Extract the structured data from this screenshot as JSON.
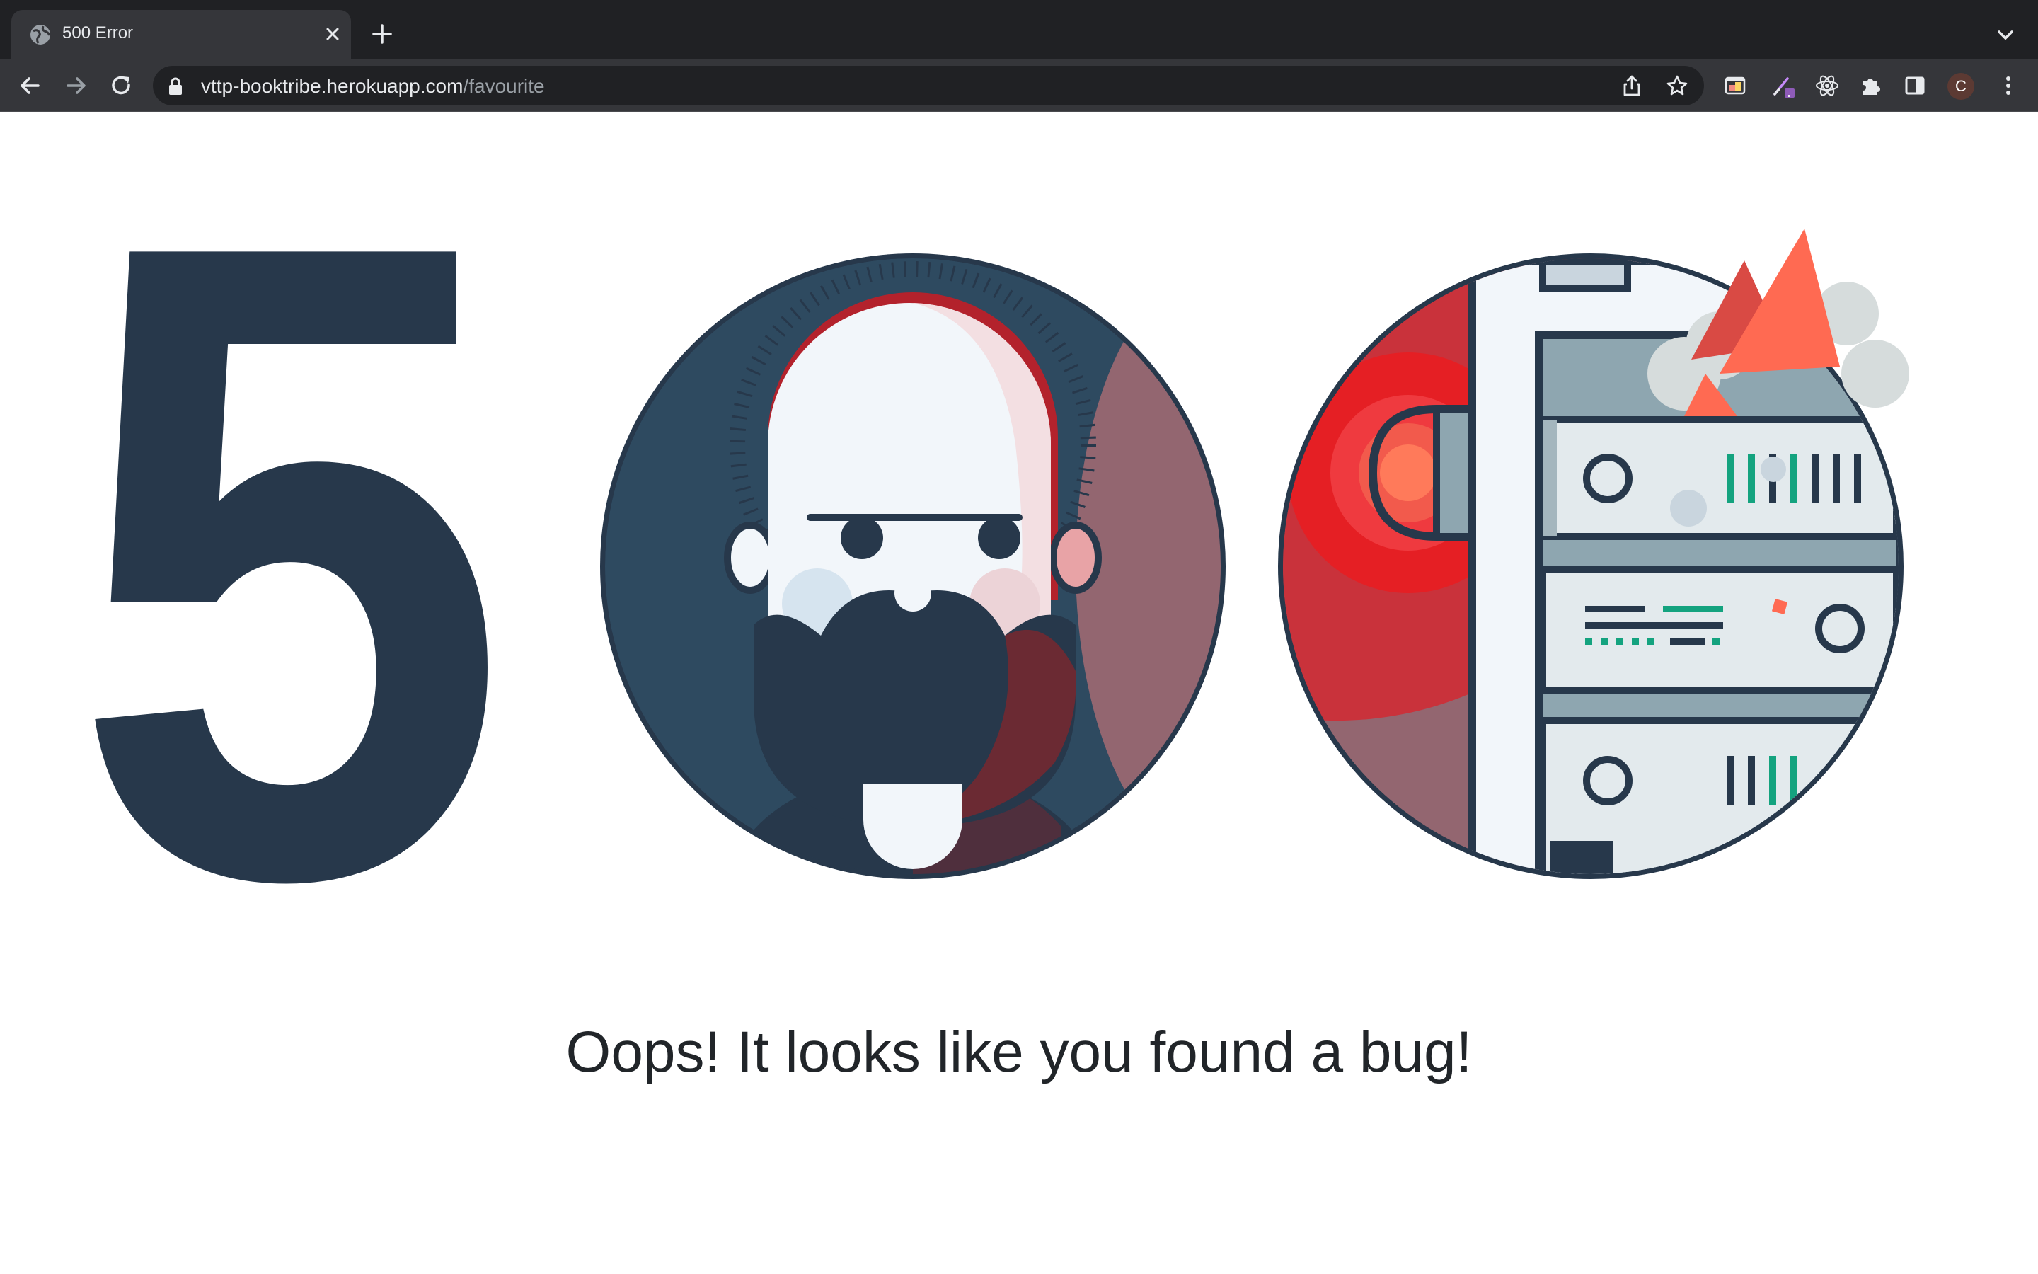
{
  "browser": {
    "tab": {
      "title": "500 Error",
      "favicon": "globe-icon"
    },
    "toolbar": {
      "back": "arrow-left-icon",
      "forward": "arrow-right-icon",
      "reload": "reload-icon",
      "url_host": "vttp-booktribe.herokuapp.com",
      "url_path": "/favourite",
      "profile_initial": "C"
    }
  },
  "page": {
    "error_code": "500",
    "message": "Oops! It looks like you found a bug!",
    "colors": {
      "navy": "#27384b",
      "red": "#e51f24",
      "coral": "#ff6a52",
      "light": "#f2f6fa"
    }
  }
}
